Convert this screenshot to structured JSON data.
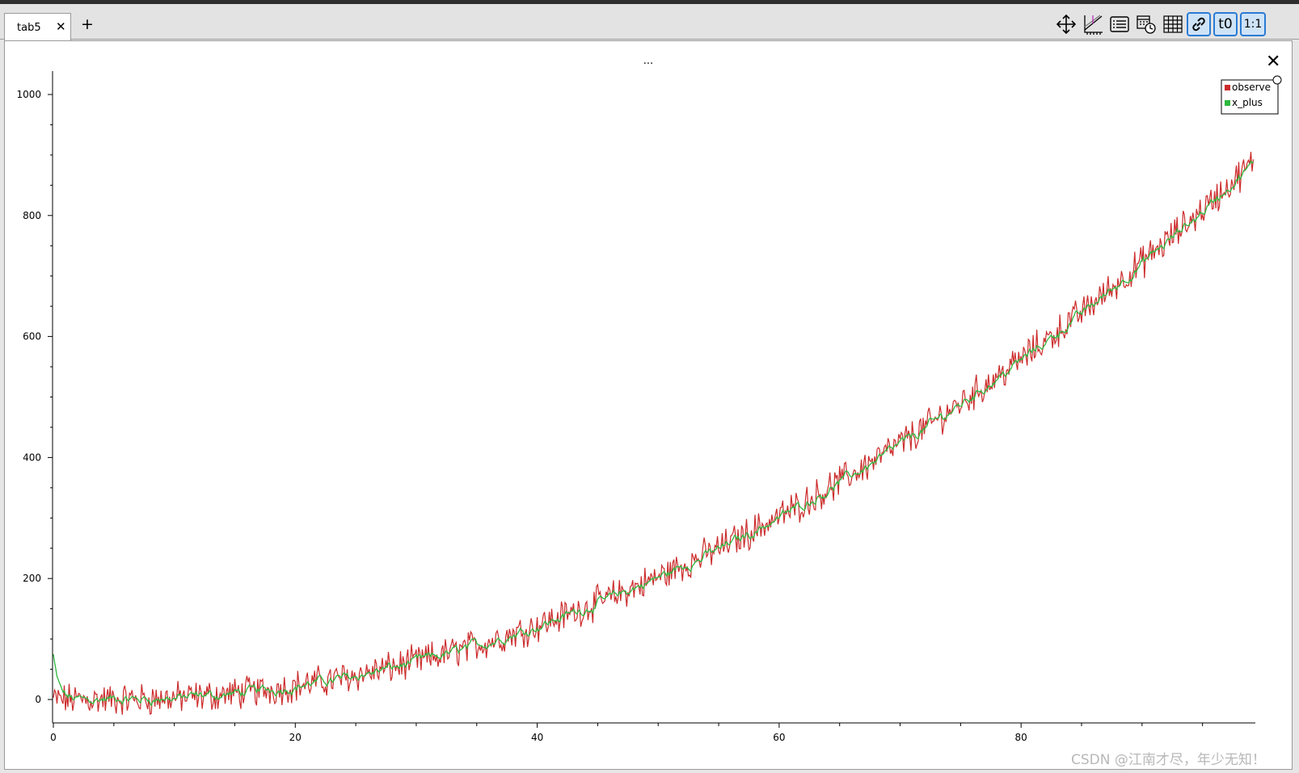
{
  "tabs": [
    {
      "label": "tab5"
    }
  ],
  "toolbar": {
    "icons": [
      "move-icon",
      "axis-scale-icon",
      "legend-list-icon",
      "time-schedule-icon",
      "grid-icon",
      "link-icon",
      "t0-icon",
      "one-to-one-icon"
    ],
    "t0_label": "t0",
    "ratio_label": "1:1"
  },
  "plot": {
    "title": "..."
  },
  "watermark": "CSDN @江南才尽，年少无知！",
  "colors": {
    "observe": "#cc2b2b",
    "x_plus": "#2db83d",
    "accent": "#2a7bd4"
  },
  "chart_data": {
    "type": "line",
    "title": "...",
    "xlabel": "",
    "ylabel": "",
    "xlim": [
      0,
      100
    ],
    "ylim": [
      -60,
      1040
    ],
    "x_ticks": [
      0,
      20,
      40,
      60,
      80
    ],
    "y_ticks": [
      0,
      200,
      400,
      600,
      800,
      1000
    ],
    "grid": false,
    "legend": "top-right",
    "series": [
      {
        "name": "observe",
        "model": "y ≈ 0.1·(x−5)² with noise",
        "x_range": [
          0,
          100
        ],
        "noise_amplitude": 22
      },
      {
        "name": "x_plus",
        "model": "filtered estimate of observe, starts near 95",
        "x_range": [
          0,
          100
        ],
        "start_value": 95
      }
    ]
  }
}
